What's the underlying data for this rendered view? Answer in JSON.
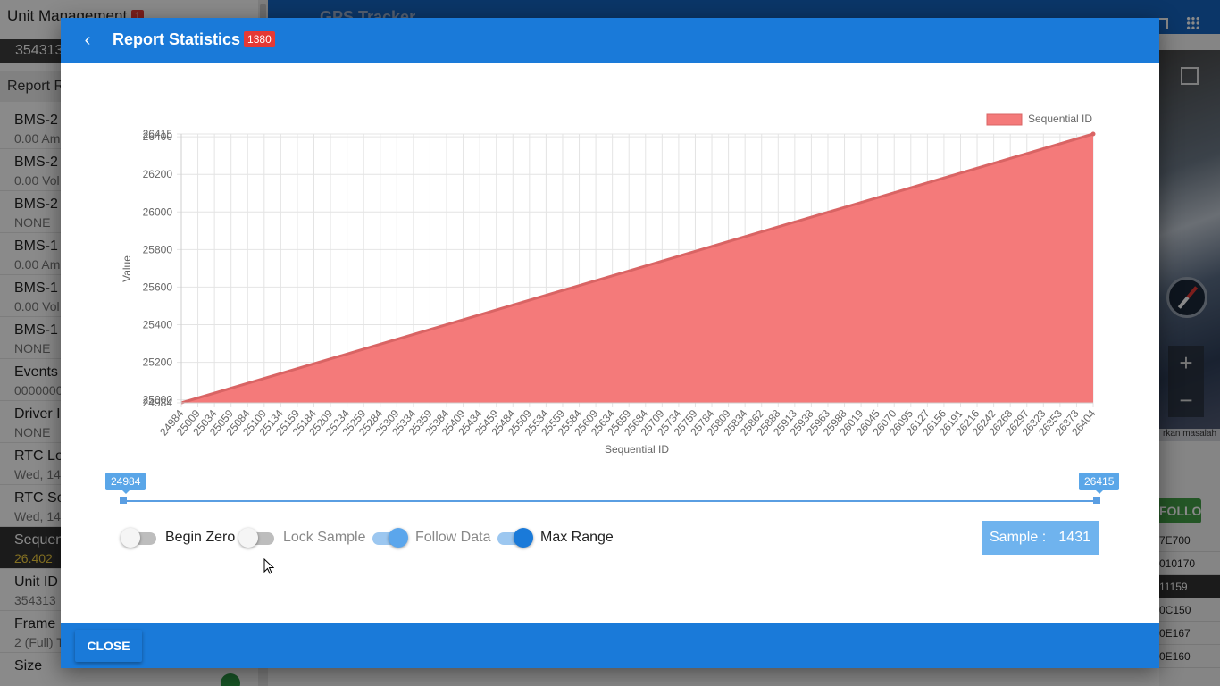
{
  "background": {
    "left_panel": {
      "title": "Unit Management",
      "badge": "1",
      "unit_id": "354313",
      "section": "Report R",
      "items": [
        {
          "name": "BMS-2",
          "value": "0.00 Am"
        },
        {
          "name": "BMS-2",
          "value": "0.00 Vol"
        },
        {
          "name": "BMS-2",
          "value": "NONE"
        },
        {
          "name": "BMS-1",
          "value": "0.00 Am"
        },
        {
          "name": "BMS-1",
          "value": "0.00 Vol"
        },
        {
          "name": "BMS-1",
          "value": "NONE"
        },
        {
          "name": "Events",
          "value": "0000000"
        },
        {
          "name": "Driver I",
          "value": "NONE"
        },
        {
          "name": "RTC Lo",
          "value": "Wed, 14"
        },
        {
          "name": "RTC Se",
          "value": "Wed, 14"
        },
        {
          "name": "Sequen",
          "value": "26.402",
          "selected": true
        },
        {
          "name": "Unit ID",
          "value": "354313"
        },
        {
          "name": "Frame",
          "value": "2 (Full) T"
        },
        {
          "name": "Size",
          "value": ""
        }
      ]
    },
    "topbar": {
      "title": "GPS Tracker"
    },
    "map": {
      "attribution": "rkan masalah"
    },
    "follow_label": "FOLLOW",
    "right_table": [
      "7E700",
      "010170",
      "11159",
      "0C150",
      "0E167",
      "0E160"
    ]
  },
  "dialog": {
    "title": "Report Statistics",
    "count": "1380",
    "close_label": "CLOSE",
    "range": {
      "min_label": "24984",
      "max_label": "26415"
    },
    "toggles": [
      {
        "label": "Begin Zero",
        "on": false
      },
      {
        "label": "Lock Sample",
        "on": false
      },
      {
        "label": "Follow Data",
        "on": true
      },
      {
        "label": "Max Range",
        "on": true
      }
    ],
    "sample": {
      "label": "Sample :",
      "value": "1431"
    }
  },
  "chart_data": {
    "type": "area",
    "xlabel": "Sequential ID",
    "ylabel": "Value",
    "legend": "Sequential ID",
    "legend_position": "top-right",
    "grid": true,
    "color": "#f47a7a",
    "line_color": "#d96464",
    "ylim": [
      24984,
      26415
    ],
    "y_ticks": [
      "24984",
      "25000",
      "25200",
      "25400",
      "25600",
      "25800",
      "26000",
      "26200",
      "26400",
      "26415"
    ],
    "x_ticks": [
      "24984",
      "25009",
      "25034",
      "25059",
      "25084",
      "25109",
      "25134",
      "25159",
      "25184",
      "25209",
      "25234",
      "25259",
      "25284",
      "25309",
      "25334",
      "25359",
      "25384",
      "25409",
      "25434",
      "25459",
      "25484",
      "25509",
      "25534",
      "25559",
      "25584",
      "25609",
      "25634",
      "25659",
      "25684",
      "25709",
      "25734",
      "25759",
      "25784",
      "25809",
      "25834",
      "25862",
      "25888",
      "25913",
      "25938",
      "25963",
      "25988",
      "26019",
      "26045",
      "26070",
      "26095",
      "26127",
      "26156",
      "26191",
      "26216",
      "26242",
      "26268",
      "26297",
      "26323",
      "26353",
      "26378",
      "26404"
    ],
    "series": [
      {
        "name": "Sequential ID",
        "x_start": 24984,
        "x_end": 26415,
        "y_start": 24984,
        "y_end": 26415
      }
    ]
  }
}
